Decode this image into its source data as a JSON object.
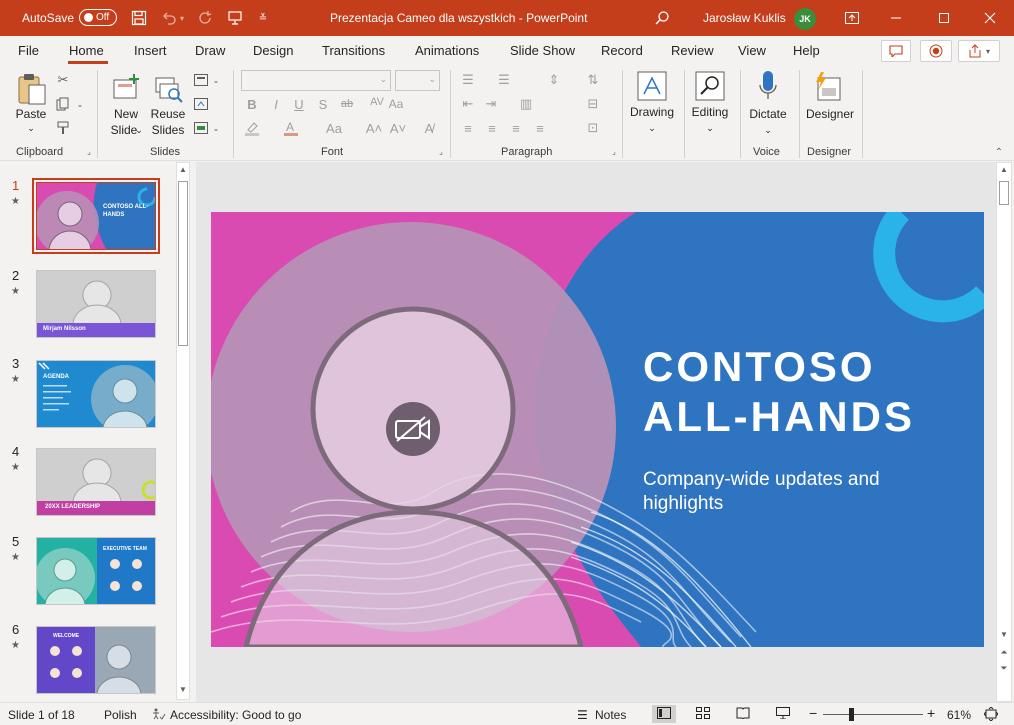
{
  "titlebar": {
    "autosave_label": "AutoSave",
    "autosave_state": "Off",
    "doc_title": "Prezentacja Cameo dla wszystkich  -  PowerPoint",
    "user_name": "Jarosław Kuklis",
    "user_initials": "JK"
  },
  "menu": {
    "tabs": [
      "File",
      "Home",
      "Insert",
      "Draw",
      "Design",
      "Transitions",
      "Animations",
      "Slide Show",
      "Record",
      "Review",
      "View",
      "Help"
    ],
    "active": "Home"
  },
  "ribbon": {
    "clipboard": {
      "paste": "Paste",
      "label": "Clipboard"
    },
    "slides": {
      "new_slide_1": "New",
      "new_slide_2": "Slide",
      "reuse_1": "Reuse",
      "reuse_2": "Slides",
      "label": "Slides"
    },
    "font": {
      "label": "Font"
    },
    "paragraph": {
      "label": "Paragraph"
    },
    "drawing": {
      "label": "Drawing"
    },
    "editing": {
      "label": "Editing"
    },
    "voice": {
      "dictate": "Dictate",
      "label": "Voice"
    },
    "designer": {
      "designer": "Designer",
      "label": "Designer"
    }
  },
  "thumbnails": [
    {
      "num": "1",
      "title": "CONTOSO ALL-HANDS",
      "sub": "Company-wide updates and highlights"
    },
    {
      "num": "2",
      "title": "Mirjam Nilsson"
    },
    {
      "num": "3",
      "title": "AGENDA"
    },
    {
      "num": "4",
      "title": "20XX LEADERSHIP"
    },
    {
      "num": "5",
      "title": "EXECUTIVE TEAM"
    },
    {
      "num": "6",
      "title": "WELCOME"
    }
  ],
  "slide": {
    "title_line1": "CONTOSO",
    "title_line2": "ALL-HANDS",
    "subtitle": "Company-wide updates and highlights"
  },
  "status": {
    "slide_indicator": "Slide 1 of 18",
    "language": "Polish",
    "accessibility": "Accessibility: Good to go",
    "notes": "Notes",
    "zoom": "61%"
  },
  "colors": {
    "accent": "#c43e1c",
    "slide_blue": "#2f74c0",
    "slide_pink": "#d94bb1",
    "slide_cyan": "#2ab3e6"
  }
}
